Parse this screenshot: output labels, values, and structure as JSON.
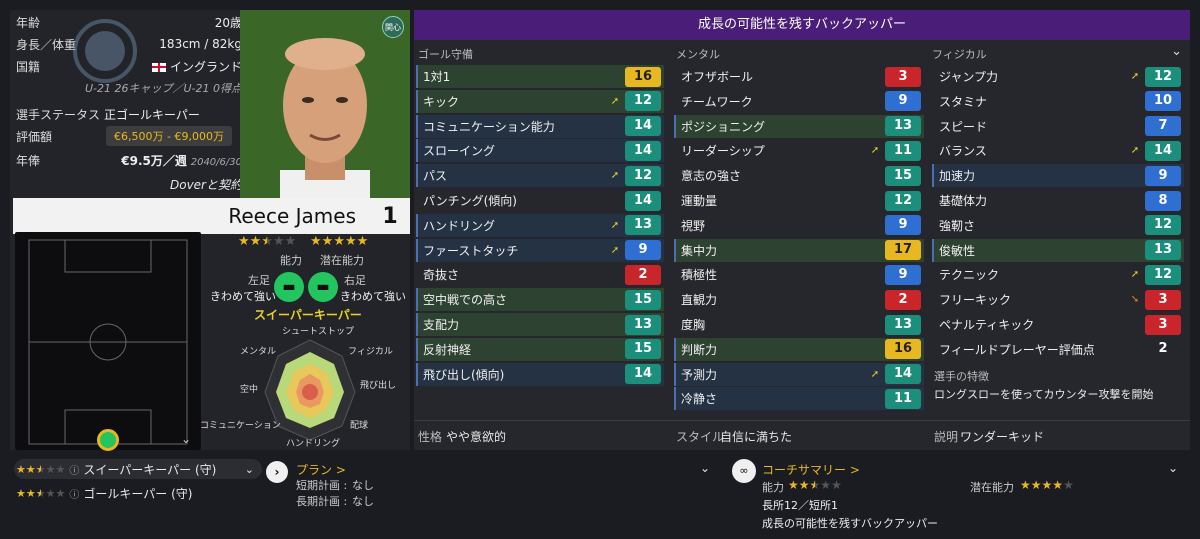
{
  "profile": {
    "age_label": "年齢",
    "age": "20歳",
    "hw_label": "身長／体重",
    "hw": "183cm / 82kg",
    "nation_label": "国籍",
    "nation": "イングランド",
    "caps": "U-21 26キャップ／U-21 0得点",
    "status_label": "選手ステータス",
    "status": "正ゴールキーパー",
    "value_label": "評価額",
    "value": "€6,500万 - €9,000万",
    "wage_label": "年俸",
    "wage": "€9.5万／週",
    "wage_until": "2040/6/30",
    "contract": "Doverと契約",
    "interest_badge": "関心",
    "name": "Reece James",
    "number": "1"
  },
  "ratings": {
    "ability_label": "能力",
    "potential_label": "潜在能力",
    "ability_stars": 2.5,
    "potential_stars": 5,
    "left_foot_label": "左足",
    "left_foot": "きわめて強い",
    "right_foot_label": "右足",
    "right_foot": "きわめて強い",
    "role": "スイーパーキーパー"
  },
  "radar": {
    "labels": [
      "シュートストップ",
      "フィジカル",
      "飛び出し",
      "配球",
      "ハンドリング",
      "コミュニケーション",
      "空中",
      "メンタル"
    ]
  },
  "panel": {
    "title": "成長の可能性を残すバックアッパー",
    "col1": "ゴール守備",
    "col2": "メンタル",
    "col3": "フィジカル"
  },
  "goalkeeping": [
    {
      "name": "1対1",
      "value": "16",
      "color": "yellow",
      "hl": "green",
      "arrow": ""
    },
    {
      "name": "キック",
      "value": "12",
      "color": "teal",
      "hl": "green",
      "arrow": "up"
    },
    {
      "name": "コミュニケーション能力",
      "value": "14",
      "color": "teal",
      "hl": "blue",
      "arrow": ""
    },
    {
      "name": "スローイング",
      "value": "14",
      "color": "teal",
      "hl": "blue",
      "arrow": ""
    },
    {
      "name": "パス",
      "value": "12",
      "color": "teal",
      "hl": "blue",
      "arrow": "up"
    },
    {
      "name": "パンチング(傾向)",
      "value": "14",
      "color": "teal",
      "hl": "",
      "arrow": ""
    },
    {
      "name": "ハンドリング",
      "value": "13",
      "color": "teal",
      "hl": "blue",
      "arrow": "up"
    },
    {
      "name": "ファーストタッチ",
      "value": "9",
      "color": "blue",
      "hl": "blue",
      "arrow": "up"
    },
    {
      "name": "奇抜さ",
      "value": "2",
      "color": "red",
      "hl": "",
      "arrow": ""
    },
    {
      "name": "空中戦での高さ",
      "value": "15",
      "color": "teal",
      "hl": "green",
      "arrow": ""
    },
    {
      "name": "支配力",
      "value": "13",
      "color": "teal",
      "hl": "green",
      "arrow": ""
    },
    {
      "name": "反射神経",
      "value": "15",
      "color": "teal",
      "hl": "green",
      "arrow": ""
    },
    {
      "name": "飛び出し(傾向)",
      "value": "14",
      "color": "teal",
      "hl": "blue",
      "arrow": ""
    }
  ],
  "mental": [
    {
      "name": "オフザボール",
      "value": "3",
      "color": "red",
      "hl": "",
      "arrow": ""
    },
    {
      "name": "チームワーク",
      "value": "9",
      "color": "blue",
      "hl": "",
      "arrow": ""
    },
    {
      "name": "ポジショニング",
      "value": "13",
      "color": "teal",
      "hl": "green",
      "arrow": ""
    },
    {
      "name": "リーダーシップ",
      "value": "11",
      "color": "teal",
      "hl": "",
      "arrow": "up"
    },
    {
      "name": "意志の強さ",
      "value": "15",
      "color": "teal",
      "hl": "",
      "arrow": ""
    },
    {
      "name": "運動量",
      "value": "12",
      "color": "teal",
      "hl": "",
      "arrow": ""
    },
    {
      "name": "視野",
      "value": "9",
      "color": "blue",
      "hl": "",
      "arrow": ""
    },
    {
      "name": "集中力",
      "value": "17",
      "color": "yellow",
      "hl": "green",
      "arrow": ""
    },
    {
      "name": "積極性",
      "value": "9",
      "color": "blue",
      "hl": "",
      "arrow": ""
    },
    {
      "name": "直観力",
      "value": "2",
      "color": "red",
      "hl": "",
      "arrow": ""
    },
    {
      "name": "度胸",
      "value": "13",
      "color": "teal",
      "hl": "",
      "arrow": ""
    },
    {
      "name": "判断力",
      "value": "16",
      "color": "yellow",
      "hl": "green",
      "arrow": ""
    },
    {
      "name": "予測力",
      "value": "14",
      "color": "teal",
      "hl": "blue",
      "arrow": "up"
    },
    {
      "name": "冷静さ",
      "value": "11",
      "color": "teal",
      "hl": "blue",
      "arrow": ""
    }
  ],
  "physical": [
    {
      "name": "ジャンプ力",
      "value": "12",
      "color": "teal",
      "hl": "",
      "arrow": "up"
    },
    {
      "name": "スタミナ",
      "value": "10",
      "color": "blue",
      "hl": "",
      "arrow": ""
    },
    {
      "name": "スピード",
      "value": "7",
      "color": "blue",
      "hl": "",
      "arrow": ""
    },
    {
      "name": "バランス",
      "value": "14",
      "color": "teal",
      "hl": "",
      "arrow": "up"
    },
    {
      "name": "加速力",
      "value": "9",
      "color": "blue",
      "hl": "blue",
      "arrow": ""
    },
    {
      "name": "基礎体力",
      "value": "8",
      "color": "blue",
      "hl": "",
      "arrow": ""
    },
    {
      "name": "強靭さ",
      "value": "12",
      "color": "teal",
      "hl": "",
      "arrow": ""
    },
    {
      "name": "俊敏性",
      "value": "13",
      "color": "teal",
      "hl": "green",
      "arrow": ""
    },
    {
      "name": "テクニック",
      "value": "12",
      "color": "teal",
      "hl": "",
      "arrow": "up"
    },
    {
      "name": "フリーキック",
      "value": "3",
      "color": "red",
      "hl": "",
      "arrow": "down"
    },
    {
      "name": "ペナルティキック",
      "value": "3",
      "color": "red",
      "hl": "",
      "arrow": ""
    },
    {
      "name": "フィールドプレーヤー評価点",
      "value": "2",
      "color": "none",
      "hl": "",
      "arrow": ""
    }
  ],
  "traits_label": "選手の特徴",
  "trait": "ロングスローを使ってカウンター攻撃を開始",
  "footer": {
    "personality_label": "性格",
    "personality": "やや意欲的",
    "style_label": "スタイル",
    "style": "自信に満ちた",
    "desc_label": "説明",
    "desc": "ワンダーキッド"
  },
  "roles": [
    {
      "name": "スイーパーキーパー (守)",
      "stars": 2.5
    },
    {
      "name": "ゴールキーパー (守)",
      "stars": 2.5
    }
  ],
  "plan": {
    "title": "プラン >",
    "short_label": "短期計画 : ",
    "short": "なし",
    "long_label": "長期計画 : ",
    "long": "なし"
  },
  "coach": {
    "title": "コーチサマリー >",
    "ability_label": "能力",
    "ability_stars": 2.5,
    "potential_label": "潜在能力",
    "potential_stars": 4,
    "counts": "長所12／短所1",
    "summary": "成長の可能性を残すバックアッパー"
  }
}
